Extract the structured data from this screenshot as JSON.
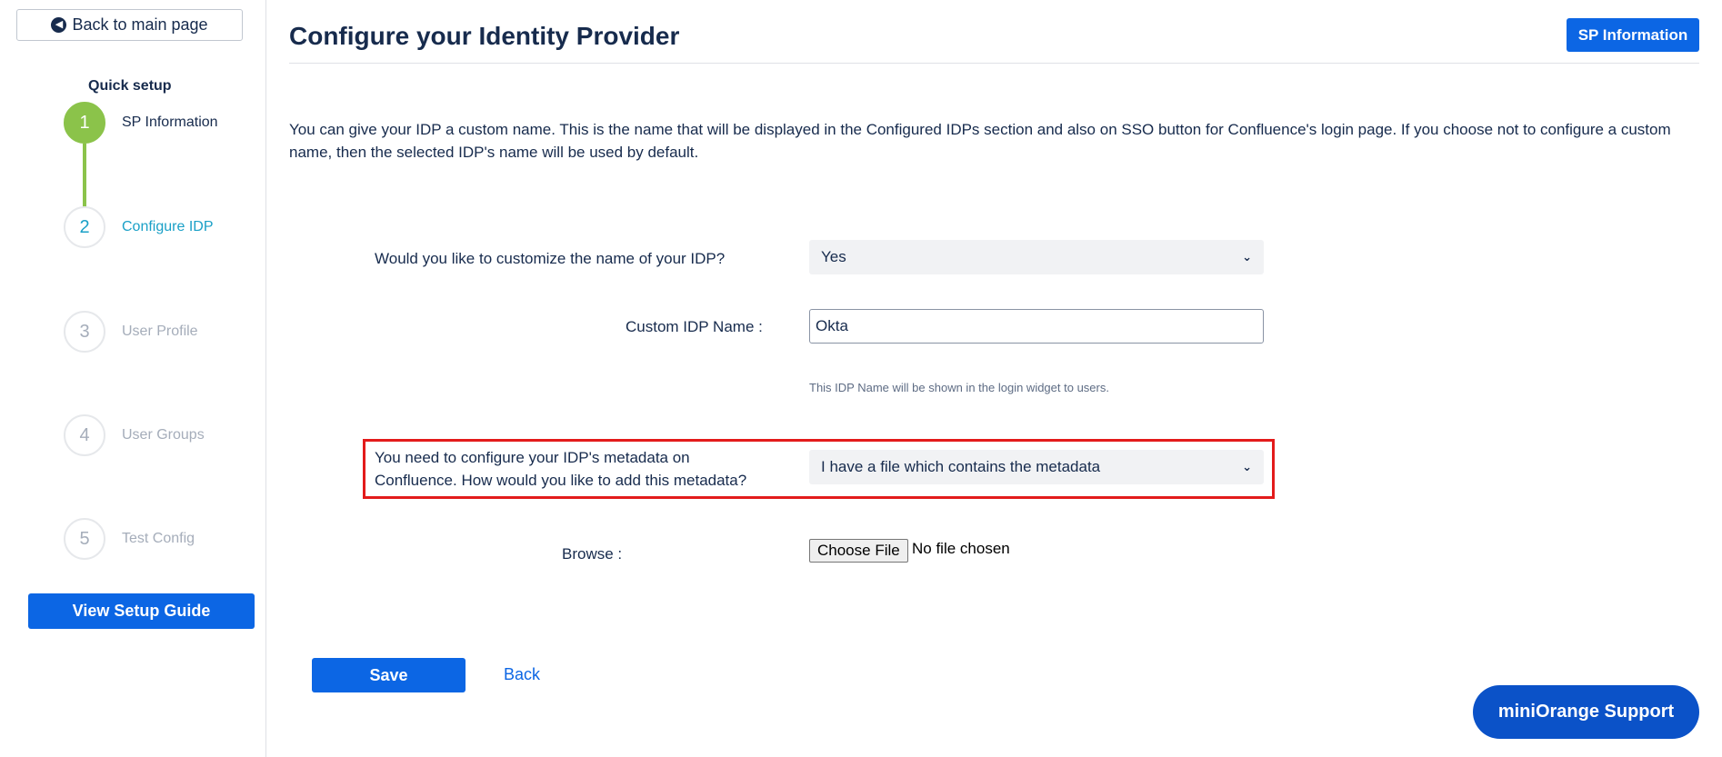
{
  "sidebar": {
    "back_label": "Back to main page",
    "quick_setup_title": "Quick setup",
    "steps": [
      {
        "number": "1",
        "label": "SP Information",
        "state": "done"
      },
      {
        "number": "2",
        "label": "Configure IDP",
        "state": "active"
      },
      {
        "number": "3",
        "label": "User Profile",
        "state": "pending"
      },
      {
        "number": "4",
        "label": "User Groups",
        "state": "pending"
      },
      {
        "number": "5",
        "label": "Test Config",
        "state": "pending"
      }
    ],
    "guide_button": "View Setup Guide"
  },
  "header": {
    "title": "Configure your Identity Provider",
    "sp_info_button": "SP Information"
  },
  "intro_text": "You can give your IDP a custom name. This is the name that will be displayed in the Configured IDPs section and also on SSO button for Confluence's login page. If you choose not to configure a custom name, then the selected IDP's name will be used by default.",
  "form": {
    "customize_label": "Would you like to customize the name of your IDP?",
    "customize_value": "Yes",
    "custom_name_label": "Custom IDP Name :",
    "custom_name_value": "Okta",
    "custom_name_hint": "This IDP Name will be shown in the login widget to users.",
    "metadata_label": "You need to configure your IDP's metadata on Confluence. How would you like to add this metadata?",
    "metadata_value": "I have a file which contains the metadata",
    "browse_label": "Browse :",
    "file_button": "Choose File",
    "file_status": "No file chosen"
  },
  "actions": {
    "save": "Save",
    "back": "Back"
  },
  "support_button": "miniOrange Support",
  "colors": {
    "primary": "#0c66e4",
    "step_done": "#8bc34a",
    "step_active": "#1aa0c7",
    "highlight": "#e31b1b"
  }
}
